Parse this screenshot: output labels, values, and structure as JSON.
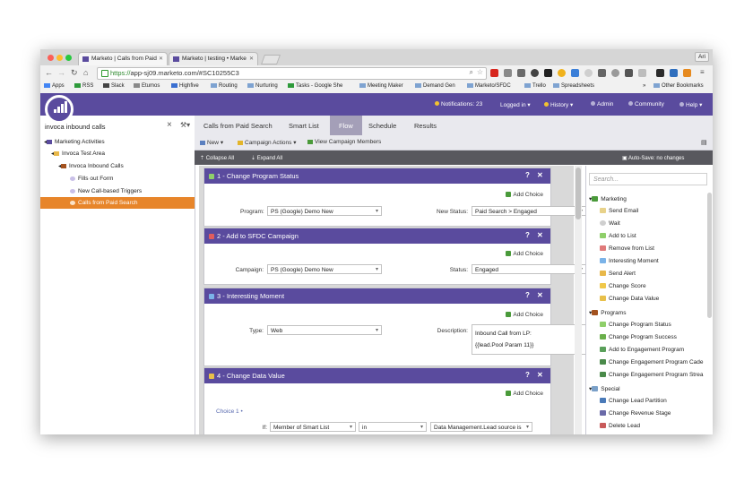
{
  "browser": {
    "tabs": [
      {
        "title": "Marketo | Calls from Paid"
      },
      {
        "title": "Marketo | testing • Marke"
      }
    ],
    "user_button": "Ari",
    "url_scheme": "https://",
    "url_rest": "app-sj09.marketo.com/#SC10255C3",
    "bookmarks": [
      "Apps",
      "RSS",
      "Slack",
      "Etumos",
      "Highfive",
      "Routing",
      "Nurturing",
      "Tasks - Google She",
      "Meeting Maker",
      "Demand Gen",
      "Marketo/SFDC",
      "Trello",
      "Spreadsheets",
      "Other Bookmarks"
    ],
    "bookmarks_overflow": "»"
  },
  "header": {
    "notifications": "Notifications: 23",
    "logged_in": "Logged in",
    "history": "History",
    "admin": "Admin",
    "community": "Community",
    "help": "Help"
  },
  "left": {
    "search_value": "invoca inbound calls",
    "clear": "×",
    "tree": [
      "Marketing Activities",
      "Invoca Test Area",
      "Invoca Inbound Calls",
      "Fills out Form",
      "New Call-based Triggers",
      "Calls from Paid Search"
    ]
  },
  "subtabs": {
    "title": "Calls from Paid Search",
    "smart_list": "Smart List",
    "flow": "Flow",
    "schedule": "Schedule",
    "results": "Results"
  },
  "actions": {
    "new": "New",
    "campaign_actions": "Campaign Actions",
    "view_members": "View Campaign Members",
    "collapse_all": "Collapse All",
    "expand_all": "Expand All",
    "autosave": "Auto-Save: no changes"
  },
  "steps": [
    {
      "title": "1 - Change Program Status",
      "add_choice": "Add Choice",
      "program_label": "Program:",
      "program_value": "PS (Google) Demo New",
      "status_label": "New Status:",
      "status_value": "Paid Search > Engaged"
    },
    {
      "title": "2 - Add to SFDC Campaign",
      "add_choice": "Add Choice",
      "campaign_label": "Campaign:",
      "campaign_value": "PS (Google) Demo New",
      "status_label": "Status:",
      "status_value": "Engaged"
    },
    {
      "title": "3 - Interesting Moment",
      "add_choice": "Add Choice",
      "type_label": "Type:",
      "type_value": "Web",
      "desc_label": "Description:",
      "desc_line1": "Inbound Call from LP:",
      "desc_line2": "{{lead.Pool Param 11}}"
    },
    {
      "title": "4 - Change Data Value",
      "add_choice": "Add Choice",
      "choice": "Choice 1 •",
      "if_label": "If:",
      "cond_field": "Member of Smart List",
      "cond_op": "in",
      "cond_value": "Data Management.Lead source is"
    }
  ],
  "palette": {
    "search_placeholder": "Search...",
    "items": [
      "Marketing",
      "Send Email",
      "Wait",
      "Add to List",
      "Remove from List",
      "Interesting Moment",
      "Send Alert",
      "Change Score",
      "Change Data Value",
      "Programs",
      "Change Program Status",
      "Change Program Success",
      "Add to Engagement Program",
      "Change Engagement Program Cade",
      "Change Engagement Program Strea",
      "Special",
      "Change Lead Partition",
      "Change Revenue Stage",
      "Delete Lead"
    ]
  },
  "colors": {
    "brand_purple": "#5a4b9e",
    "selected_orange": "#e7852a"
  }
}
